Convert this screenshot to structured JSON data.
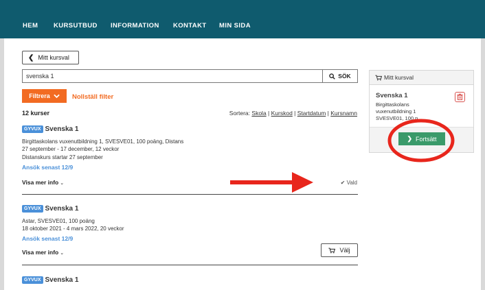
{
  "nav": {
    "items": [
      "HEM",
      "KURSUTBUD",
      "INFORMATION",
      "KONTAKT",
      "MIN SIDA"
    ]
  },
  "back_button": {
    "label": "Mitt kursval",
    "icon": "chevron-left-icon"
  },
  "search": {
    "value": "svenska 1",
    "button_label": "SÖK",
    "icon": "search-icon"
  },
  "filter": {
    "button_label": "Filtrera",
    "reset_label": "Nollställ filter"
  },
  "results": {
    "count_label": "12 kurser",
    "sort_label": "Sortera:",
    "sort_options": [
      "Skola",
      "Kurskod",
      "Startdatum",
      "Kursnamn"
    ]
  },
  "courses": [
    {
      "badge": "GYVUX",
      "title": "Svenska 1",
      "lines": [
        "Birgittaskolans vuxenutbildning 1, SVESVE01, 100 poäng, Distans",
        "27 september - 17 december, 12 veckor",
        "Distanskurs startar 27 september"
      ],
      "apply": "Ansök senast 12/9",
      "more": "Visa mer info",
      "status": "Vald"
    },
    {
      "badge": "GYVUX",
      "title": "Svenska 1",
      "lines": [
        "Astar, SVESVE01, 100 poäng",
        "18 oktober 2021 - 4 mars 2022, 20 veckor"
      ],
      "apply": "Ansök senast 12/9",
      "more": "Visa mer info",
      "select_label": "Välj"
    },
    {
      "badge": "GYVUX",
      "title": "Svenska 1"
    }
  ],
  "cart": {
    "header": "Mitt kursval",
    "title": "Svenska 1",
    "lines": [
      "Birgittaskolans",
      "vuxenutbildning 1",
      "SVESVE01, 100 p..."
    ],
    "continue_label": "Fortsätt"
  },
  "colors": {
    "nav_bg": "#0f5b6e",
    "accent_orange": "#f26b22",
    "badge_blue": "#4a90d9",
    "continue_green": "#3a9a6a",
    "annotation_red": "#e8261c"
  }
}
